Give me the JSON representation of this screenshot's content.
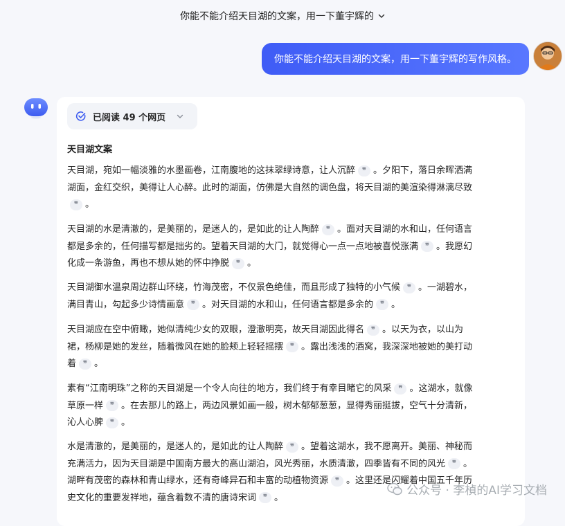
{
  "topbar": {
    "title": "你能不能介绍天目湖的文案，用一下董宇辉的"
  },
  "user_message": {
    "text": "你能不能介绍天目湖的文案，用一下董宇辉的写作风格。"
  },
  "read_pill": {
    "label": "已阅读 49 个网页"
  },
  "answer": {
    "heading": "天目湖文案",
    "paragraphs": [
      {
        "lines": [
          [
            "天目湖，宛如一幅淡雅的水墨画卷，江南腹地的这抹翠绿诗意，让人沉醉",
            "q",
            "。夕阳下，落日余晖洒满"
          ],
          [
            "湖面，金红交织，美得让人心醉。此时的湖面，仿佛是大自然的调色盘，将天目湖的美渲染得淋漓尽致"
          ],
          [
            "q",
            "。"
          ]
        ]
      },
      {
        "lines": [
          [
            "天目湖的水是清澈的，是美丽的，是迷人的，是如此的让人陶醉",
            "q",
            "。面对天目湖的水和山，任何语言"
          ],
          [
            "都是多余的，任何描写都是拙劣的。望着天目湖的大门，就觉得心一点一点地被喜悦涨满",
            "q",
            "。我愿幻"
          ],
          [
            "化成一条游鱼，再也不想从她的怀中挣脱",
            "q",
            "。"
          ]
        ]
      },
      {
        "lines": [
          [
            "天目湖御水温泉周边群山环绕，竹海茂密，不仅景色绝佳，而且形成了独特的小气候",
            "q",
            "。一湖碧水，"
          ],
          [
            "满目青山，勾起多少诗情画意",
            "q",
            "。对天目湖的水和山，任何语言都是多余的",
            "q",
            "。"
          ]
        ]
      },
      {
        "lines": [
          [
            "天目湖应在空中俯瞰，她似清纯少女的双眼，澄澈明亮，故天目湖因此得名",
            "q",
            "。以天为衣，以山为"
          ],
          [
            "裙，杨柳是她的发丝，随着微风在她的脸颊上轻轻摇摆",
            "q",
            "。露出浅浅的酒窝，我深深地被她的美打动"
          ],
          [
            "着",
            "q",
            "。"
          ]
        ]
      },
      {
        "lines": [
          [
            "素有“江南明珠”之称的天目湖是一个令人向往的地方，我们终于有幸目睹它的风采",
            "q",
            "。这湖水，就像"
          ],
          [
            "草原一样",
            "q",
            "。在去那儿的路上，两边风景如画一般，树木郁郁葱葱，显得秀丽挺拔，空气十分清新，"
          ],
          [
            "沁人心脾",
            "q",
            "。"
          ]
        ]
      },
      {
        "lines": [
          [
            "水是清澈的，是美丽的，是迷人的，是如此的让人陶醉",
            "q",
            "。望着这湖水，我不愿离开。美丽、神秘而"
          ],
          [
            "充满活力，因为天目湖是中国南方最大的高山湖泊，风光秀丽，水质清澈，四季皆有不同的风光",
            "q",
            "。"
          ],
          [
            "湖畔有茂密的森林和青山绿水，还有奇峰异石和丰富的动植物资源",
            "q",
            "。这里还是闪耀着中国五千年历"
          ],
          [
            "史文化的重要发祥地，蕴含着数不清的唐诗宋词",
            "q",
            "。"
          ]
        ]
      }
    ]
  },
  "citation_glyph": "❞",
  "watermark": {
    "text": "公众号 · 李楨的AI学习文档"
  },
  "colors": {
    "accent": "#4b6bff",
    "card": "#ffffff",
    "background": "#f6f7fb"
  }
}
